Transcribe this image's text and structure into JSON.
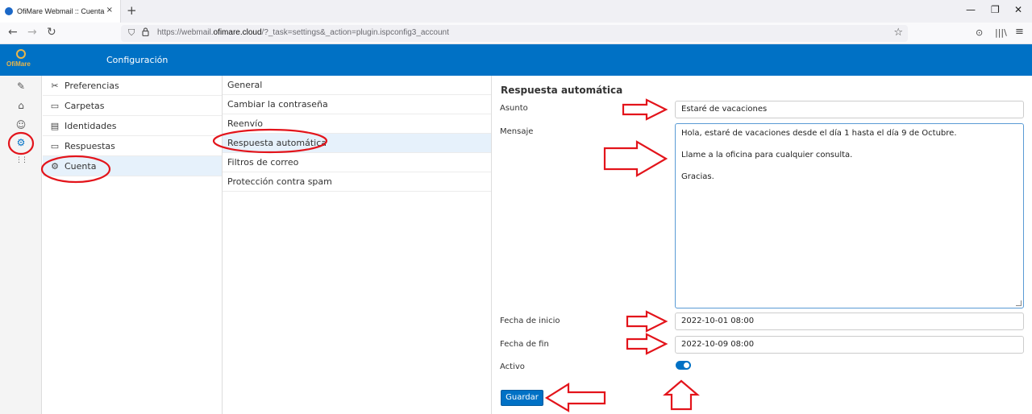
{
  "browser": {
    "tab_title": "OfiMare Webmail :: Cuenta",
    "tab_close": "×",
    "new_tab": "+",
    "url_prefix": "https://webmail.",
    "url_domain": "ofimare.cloud",
    "url_path": "/?_task=settings&_action=plugin.ispconfig3_account",
    "win_min": "—",
    "win_max": "❐",
    "win_close": "✕",
    "back": "←",
    "forward": "→",
    "reload": "↻",
    "shield": "⛉",
    "lock": "🔒",
    "bookmark": "☆",
    "pocket": "⊙",
    "library": "|||\\",
    "menu": "≡"
  },
  "app": {
    "logo_text": "OfiMare",
    "section_title": "Configuración"
  },
  "rail": {
    "icons": [
      "compose-icon",
      "contacts-icon",
      "people-icon",
      "settings-icon",
      "apps-icon"
    ],
    "glyphs": [
      "✎",
      "⌂",
      "☺",
      "⚙",
      "⋮⋮"
    ]
  },
  "settings_menu": {
    "items": [
      {
        "label": "Preferencias",
        "icon": "✂"
      },
      {
        "label": "Carpetas",
        "icon": "▭"
      },
      {
        "label": "Identidades",
        "icon": "▤"
      },
      {
        "label": "Respuestas",
        "icon": "▭"
      },
      {
        "label": "Cuenta",
        "icon": "⚙"
      }
    ],
    "selected": "Cuenta"
  },
  "account_sections": {
    "items": [
      "General",
      "Cambiar la contraseña",
      "Reenvío",
      "Respuesta automática",
      "Filtros de correo",
      "Protección contra spam"
    ],
    "selected": "Respuesta automática"
  },
  "form": {
    "title": "Respuesta automática",
    "subject_label": "Asunto",
    "subject_value": "Estaré de vacaciones",
    "message_label": "Mensaje",
    "message_lines": [
      "Hola, estaré de vacaciones desde el día 1 hasta el día 9 de Octubre.",
      "Llame a la oficina para cualquier consulta.",
      "Gracias."
    ],
    "start_label": "Fecha de inicio",
    "start_value": "2022-10-01 08:00",
    "end_label": "Fecha de fin",
    "end_value": "2022-10-09 08:00",
    "active_label": "Activo",
    "active_value": true,
    "save_label": "Guardar"
  },
  "colors": {
    "brand_blue": "#0071c5",
    "annotation_red": "#e3141b",
    "selected_bg": "#e6f1fb"
  }
}
